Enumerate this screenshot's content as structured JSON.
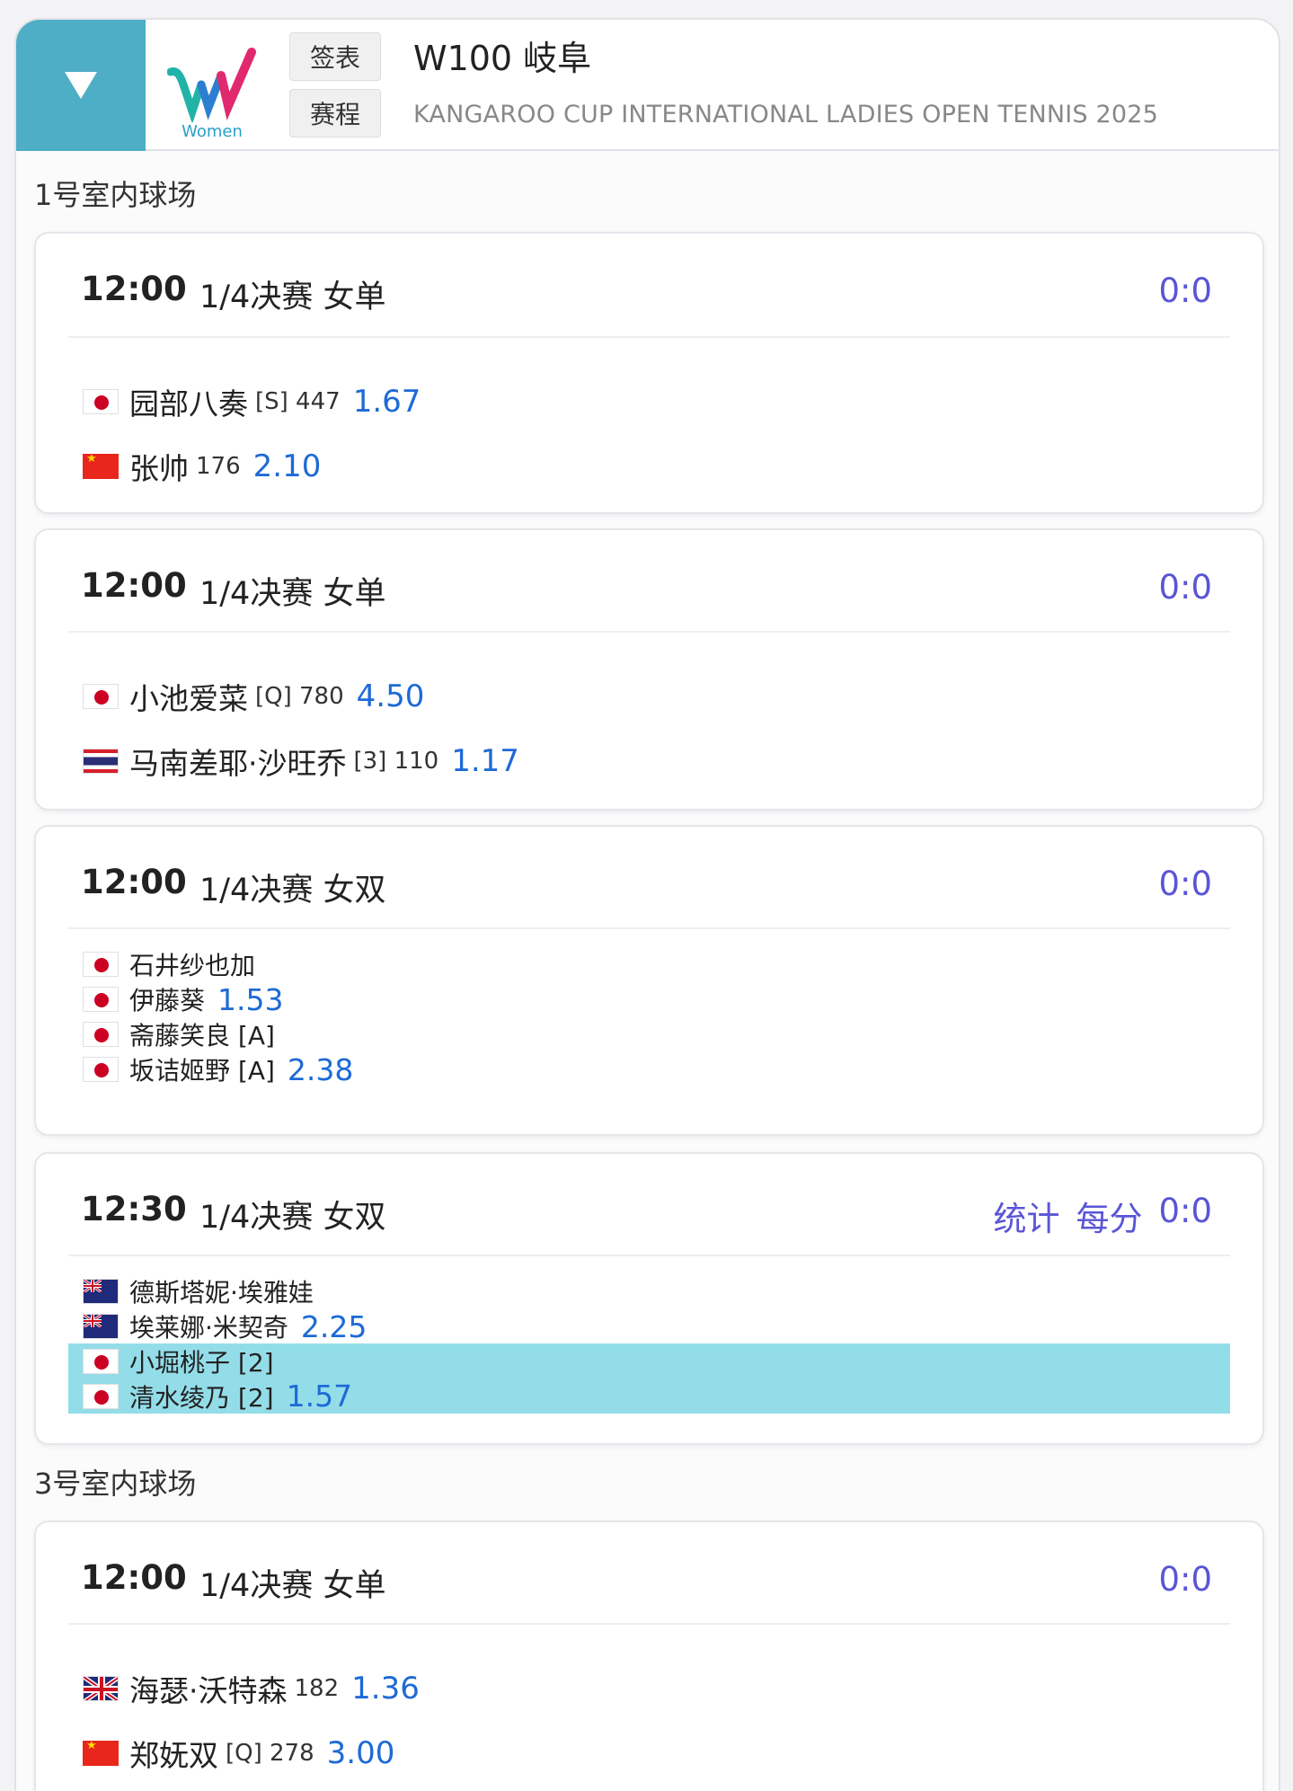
{
  "header": {
    "logo_label": "Women",
    "btn_draw": "签表",
    "btn_schedule": "赛程",
    "title": "W100 岐阜",
    "subtitle": "KANGAROO CUP INTERNATIONAL LADIES OPEN TENNIS 2025"
  },
  "courts": [
    {
      "name": "1号室内球场",
      "matches": [
        {
          "time": "12:00",
          "round": "1/4决赛 女单",
          "score": "0:0",
          "players": [
            {
              "name": "园部八奏",
              "meta": "[S] 447",
              "odds": "1.67",
              "flag": "jp"
            },
            {
              "name": "张帅",
              "meta": "176",
              "odds": "2.10",
              "flag": "cn"
            }
          ]
        },
        {
          "time": "12:00",
          "round": "1/4决赛 女单",
          "score": "0:0",
          "players": [
            {
              "name": "小池爱菜",
              "meta": "[Q] 780",
              "odds": "4.50",
              "flag": "jp"
            },
            {
              "name": "马南差耶·沙旺乔",
              "meta": "[3] 110",
              "odds": "1.17",
              "flag": "th"
            }
          ]
        },
        {
          "time": "12:00",
          "round": "1/4决赛 女双",
          "score": "0:0",
          "players": [
            {
              "name": "石井纱也加",
              "meta": "",
              "odds": "",
              "flag": "jp"
            },
            {
              "name": "伊藤葵",
              "meta": "",
              "odds": "1.53",
              "flag": "jp"
            },
            {
              "name": "斋藤笑良 [A]",
              "meta": "",
              "odds": "",
              "flag": "jp"
            },
            {
              "name": "坂诘姬野 [A]",
              "meta": "",
              "odds": "2.38",
              "flag": "jp"
            }
          ]
        },
        {
          "time": "12:30",
          "round": "1/4决赛 女双",
          "score": "0:0",
          "stats_label": "统计",
          "per_point_label": "每分",
          "players": [
            {
              "name": "德斯塔妮·埃雅娃",
              "meta": "",
              "odds": "",
              "flag": "au"
            },
            {
              "name": "埃莱娜·米契奇",
              "meta": "",
              "odds": "2.25",
              "flag": "au"
            },
            {
              "name": "小堀桃子 [2]",
              "meta": "",
              "odds": "",
              "flag": "jp"
            },
            {
              "name": "清水绫乃 [2]",
              "meta": "",
              "odds": "1.57",
              "flag": "jp"
            }
          ]
        }
      ]
    },
    {
      "name": "3号室内球场",
      "matches": [
        {
          "time": "12:00",
          "round": "1/4决赛 女单",
          "score": "0:0",
          "players": [
            {
              "name": "海瑟·沃特森",
              "meta": "182",
              "odds": "1.36",
              "flag": "gb"
            },
            {
              "name": "郑妩双",
              "meta": "[Q] 278",
              "odds": "3.00",
              "flag": "cn"
            }
          ]
        }
      ]
    }
  ],
  "colors": {
    "toggle_bg": "#4eaec6",
    "score_text": "#5a55d6",
    "odds_text": "#1e6ad6",
    "highlight_row": "#93dde9"
  },
  "icons": {
    "toggle": "triangle-down-icon",
    "logo": "wta-women-logo"
  }
}
